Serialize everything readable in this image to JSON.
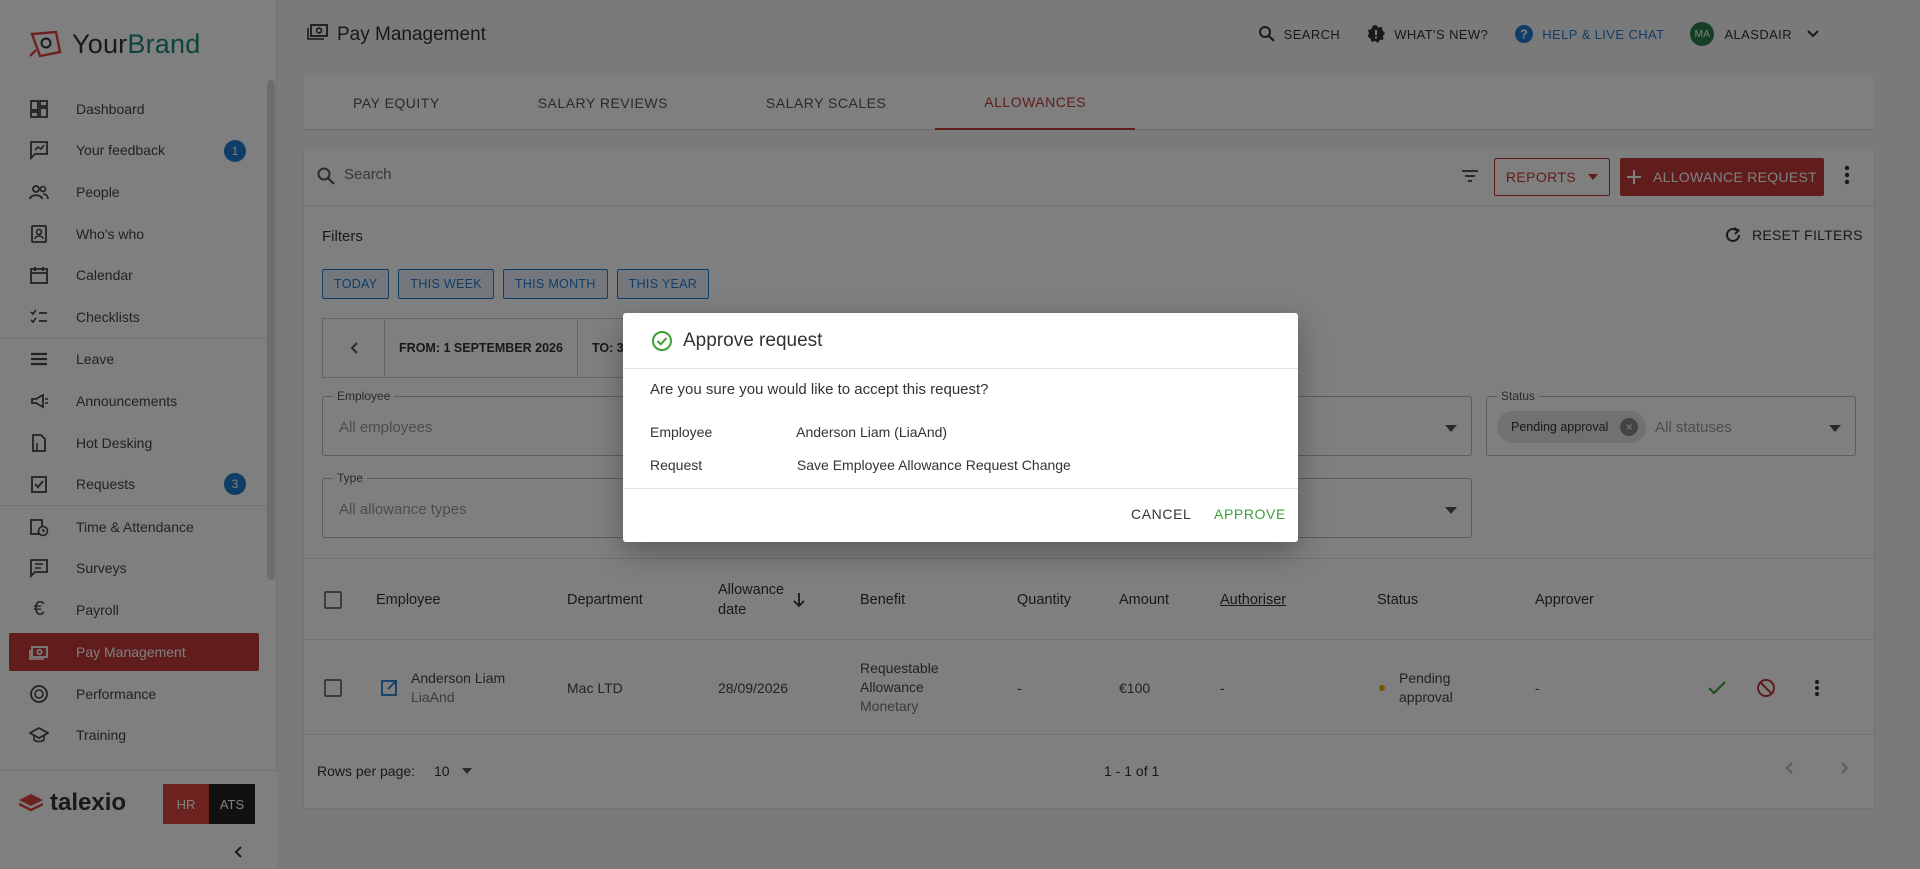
{
  "brand": {
    "name_part1": "Your",
    "name_part2": "Brand"
  },
  "sidebar": {
    "items": [
      {
        "label": "Dashboard",
        "icon": "dashboard-icon"
      },
      {
        "label": "Your feedback",
        "icon": "feedback-icon",
        "badge": "1"
      },
      {
        "label": "People",
        "icon": "people-icon"
      },
      {
        "label": "Who's who",
        "icon": "contact-card-icon"
      },
      {
        "label": "Calendar",
        "icon": "calendar-icon"
      },
      {
        "label": "Checklists",
        "icon": "checklist-icon"
      },
      {
        "label": "Leave",
        "icon": "leave-icon"
      },
      {
        "label": "Announcements",
        "icon": "megaphone-icon"
      },
      {
        "label": "Hot Desking",
        "icon": "desk-icon"
      },
      {
        "label": "Requests",
        "icon": "requests-icon",
        "badge": "3"
      },
      {
        "label": "Time & Attendance",
        "icon": "clock-icon"
      },
      {
        "label": "Surveys",
        "icon": "survey-icon"
      },
      {
        "label": "Payroll",
        "icon": "euro-icon"
      },
      {
        "label": "Pay Management",
        "icon": "money-icon"
      },
      {
        "label": "Performance",
        "icon": "performance-icon"
      },
      {
        "label": "Training",
        "icon": "graduation-cap-icon"
      }
    ],
    "active_item": "Pay Management",
    "footer": {
      "logo_text": "talexio",
      "hr_label": "HR",
      "ats_label": "ATS"
    }
  },
  "header": {
    "title": "Pay Management",
    "search_label": "SEARCH",
    "whats_new_label": "WHAT'S NEW?",
    "help_label": "HELP & LIVE CHAT",
    "user_initials": "MA",
    "user_name": "ALASDAIR"
  },
  "tabs": [
    {
      "label": "PAY EQUITY"
    },
    {
      "label": "SALARY REVIEWS"
    },
    {
      "label": "SALARY SCALES"
    },
    {
      "label": "ALLOWANCES",
      "active": true
    }
  ],
  "toolbar": {
    "search_placeholder": "Search",
    "reports_label": "REPORTS",
    "allowance_request_label": "ALLOWANCE REQUEST"
  },
  "filters": {
    "title": "Filters",
    "reset_label": "RESET FILTERS",
    "quick": [
      "TODAY",
      "THIS WEEK",
      "THIS MONTH",
      "THIS YEAR"
    ],
    "date_from": "FROM: 1 SEPTEMBER 2026",
    "date_to": "TO: 3",
    "employee_label": "Employee",
    "employee_value": "All employees",
    "status_label": "Status",
    "status_chip": "Pending approval",
    "status_placeholder": "All statuses",
    "type_label": "Type",
    "type_value": "All allowance types"
  },
  "table": {
    "columns": [
      "Employee",
      "Department",
      "Allowance",
      "date",
      "Benefit",
      "Quantity",
      "Amount",
      "Authoriser",
      "Status",
      "Approver"
    ],
    "rows": [
      {
        "employee_name": "Anderson Liam",
        "employee_code": "LiaAnd",
        "department": "Mac LTD",
        "date": "28/09/2026",
        "benefit_line1": "Requestable",
        "benefit_line2": "Allowance",
        "benefit_line3": "Monetary",
        "quantity": "-",
        "amount": "€100",
        "authoriser": "-",
        "status_line1": "Pending",
        "status_line2": "approval",
        "approver": "-"
      }
    ]
  },
  "pagination": {
    "rows_per_page_label": "Rows per page:",
    "rows_per_page_value": "10",
    "range": "1 - 1 of 1"
  },
  "dialog": {
    "title": "Approve request",
    "question": "Are you sure you would like to accept this request?",
    "employee_label": "Employee",
    "employee_value": "Anderson Liam (LiaAnd)",
    "request_label": "Request",
    "request_value": "Save Employee Allowance Request Change",
    "cancel_label": "CANCEL",
    "approve_label": "APPROVE"
  },
  "colors": {
    "accent": "#c13a38",
    "link": "#1f7bd1",
    "success": "#3aa135",
    "pending": "#f0b000"
  }
}
